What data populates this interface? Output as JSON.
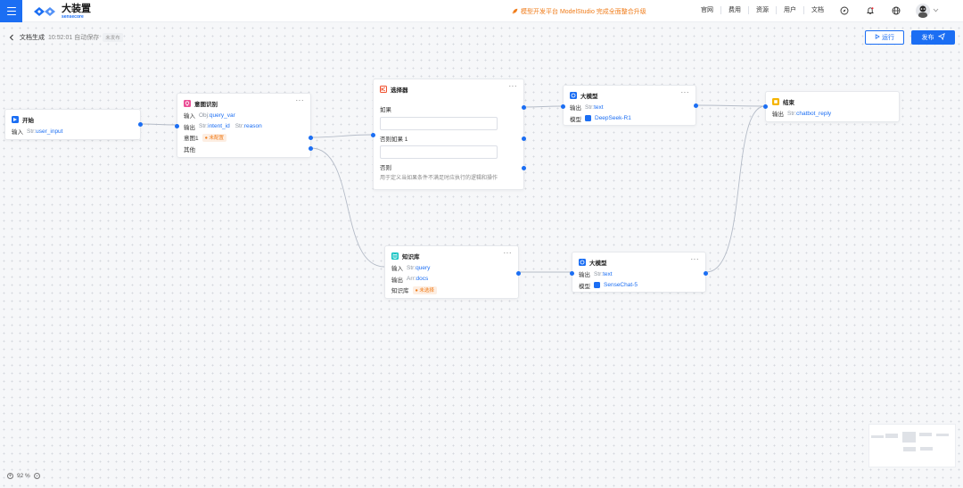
{
  "app": {
    "logo_cn": "大装置",
    "logo_en": "sensecore",
    "announcement": "模型开发平台 ModelStudio 完成全面整合升级",
    "nav_links": [
      "官网",
      "费用",
      "资源",
      "用户",
      "文档"
    ]
  },
  "toolbar": {
    "doc_title": "文档生成",
    "save_status": "10:52:01 自动保存",
    "publish_badge": "未发布",
    "run_label": "运行",
    "publish_label": "发布"
  },
  "nodes": {
    "start": {
      "title": "开始",
      "input_label": "输入",
      "input_type": "Str:",
      "input_value": "user_input"
    },
    "intent": {
      "title": "意图识别",
      "more": "···",
      "input_label": "输入",
      "input_type": "Obj:",
      "input_value": "query_var",
      "output_label": "输出",
      "out1_type": "Str:",
      "out1_value": "intent_id",
      "out2_type": "Str:",
      "out2_value": "reason",
      "intent_label": "意图1",
      "intent_tag": "未配置",
      "other_label": "其他"
    },
    "selector": {
      "title": "选择器",
      "more": "···",
      "if_label": "如果",
      "elif_label": "否则如果 1",
      "else_label": "否则",
      "help": "用于定义当如果条件不满足时应执行的逻辑和操作"
    },
    "llm1": {
      "title": "大模型",
      "more": "···",
      "output_label": "输出",
      "output_type": "Str:",
      "output_value": "text",
      "model_label": "模型",
      "model_value": "DeepSeek-R1"
    },
    "end": {
      "title": "结束",
      "output_label": "输出",
      "output_type": "Str:",
      "output_value": "chatbot_reply"
    },
    "kb": {
      "title": "知识库",
      "more": "···",
      "input_label": "输入",
      "input_type": "Str:",
      "input_value": "query",
      "output_label": "输出",
      "output_type": "Arr:",
      "output_value": "docs",
      "kb_label": "知识库",
      "kb_tag": "未选择"
    },
    "llm2": {
      "title": "大模型",
      "more": "···",
      "output_label": "输出",
      "output_type": "Str:",
      "output_value": "text",
      "model_label": "模型",
      "model_value": "SenseChat-5"
    }
  },
  "zoom": {
    "level": "92 %"
  },
  "colors": {
    "accent": "#1b6ef3",
    "warning": "#f07c1a",
    "edge": "#b5bcc8"
  }
}
